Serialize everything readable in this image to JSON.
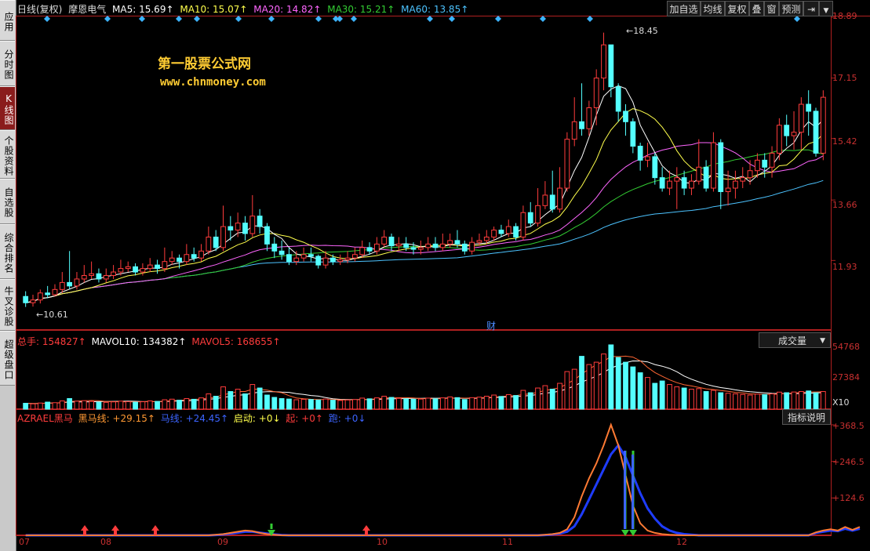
{
  "sidebar": {
    "items": [
      {
        "label": "应用"
      },
      {
        "label": "分时图"
      },
      {
        "label": "K线图"
      },
      {
        "label": "个股资料"
      },
      {
        "label": "自选股"
      },
      {
        "label": "综合排名"
      },
      {
        "label": "牛叉诊股"
      },
      {
        "label": "超级盘口"
      }
    ]
  },
  "toolbar": {
    "add_watch": "加自选",
    "ma_line": "均线",
    "rights": "复权",
    "overlay": "叠",
    "window": "窗",
    "forecast": "预测",
    "exit_icon": "exit-icon",
    "menu_icon": "triangle-down-icon"
  },
  "kline_header": {
    "period": "日线(复权)",
    "stock_name": "摩恩电气",
    "ma5": "MA5: 15.69↑",
    "ma10": "MA10: 15.07↑",
    "ma20": "MA20: 14.82↑",
    "ma30": "MA30: 15.21↑",
    "ma60": "MA60: 13.85↑"
  },
  "watermark": {
    "line1": "第一股票公式网",
    "line2": "www.chnmoney.com"
  },
  "price_axis": [
    "18.89",
    "17.15",
    "15.42",
    "13.66",
    "11.93"
  ],
  "price_annotations": {
    "high": "18.45",
    "low": "10.61",
    "cai": "财"
  },
  "volume_header": {
    "total": "总手: 154827↑",
    "mavol10": "MAVOL10: 134382↑",
    "mavol5": "MAVOL5: 168655↑",
    "selector": "成交量"
  },
  "volume_axis": [
    "54768",
    "27384",
    "X10"
  ],
  "indicator_header": {
    "name": "AZRAEL黑马",
    "heima": "黑马线: +29.15↑",
    "ma": "马线: +24.45↑",
    "qidong": "启动: +0↓",
    "qi": "起: +0↑",
    "pao": "跑: +0↓",
    "help": "指标说明"
  },
  "indicator_axis": [
    "+368.5",
    "+246.5",
    "+124.6"
  ],
  "x_axis": [
    "07",
    "08",
    "09",
    "10",
    "11",
    "12"
  ],
  "colors": {
    "up": "#ff3c3c",
    "down": "#54ffff",
    "ma5": "#ffffff",
    "ma10": "#ffff4c",
    "ma20": "#ff66ff",
    "ma30": "#33cc33",
    "ma60": "#4cc3ff",
    "frame": "#b02020"
  },
  "chart_data": {
    "type": "candlestick",
    "price_range": [
      10.3,
      18.89
    ],
    "candles": [
      [
        10.9,
        10.72,
        11.05,
        10.6
      ],
      [
        10.72,
        10.8,
        10.95,
        10.61
      ],
      [
        10.8,
        11.0,
        11.1,
        10.7
      ],
      [
        11.0,
        10.95,
        11.2,
        10.85
      ],
      [
        10.95,
        11.1,
        11.25,
        10.9
      ],
      [
        11.1,
        11.3,
        11.6,
        11.0
      ],
      [
        11.3,
        11.2,
        12.2,
        11.1
      ],
      [
        11.2,
        11.4,
        11.6,
        11.1
      ],
      [
        11.4,
        11.5,
        11.8,
        11.3
      ],
      [
        11.5,
        11.55,
        11.9,
        11.4
      ],
      [
        11.55,
        11.4,
        11.7,
        11.3
      ],
      [
        11.4,
        11.5,
        11.7,
        11.3
      ],
      [
        11.5,
        11.6,
        11.8,
        11.4
      ],
      [
        11.6,
        11.7,
        11.95,
        11.5
      ],
      [
        11.7,
        11.75,
        11.9,
        11.6
      ],
      [
        11.75,
        11.6,
        11.85,
        11.5
      ],
      [
        11.6,
        11.7,
        11.85,
        11.5
      ],
      [
        11.7,
        11.8,
        12.0,
        11.6
      ],
      [
        11.8,
        11.7,
        11.95,
        11.55
      ],
      [
        11.7,
        11.9,
        12.3,
        11.6
      ],
      [
        11.9,
        12.0,
        12.2,
        11.8
      ],
      [
        12.0,
        11.9,
        12.1,
        11.7
      ],
      [
        11.9,
        12.1,
        12.4,
        11.8
      ],
      [
        12.1,
        12.0,
        12.3,
        11.9
      ],
      [
        12.0,
        12.2,
        12.4,
        11.9
      ],
      [
        12.2,
        12.6,
        12.9,
        12.1
      ],
      [
        12.6,
        12.3,
        12.8,
        12.2
      ],
      [
        12.3,
        12.9,
        13.5,
        12.2
      ],
      [
        12.9,
        12.8,
        13.2,
        12.5
      ],
      [
        12.8,
        13.0,
        13.3,
        12.6
      ],
      [
        13.0,
        12.7,
        13.2,
        12.5
      ],
      [
        12.7,
        13.2,
        13.8,
        12.6
      ],
      [
        13.2,
        12.9,
        13.4,
        12.7
      ],
      [
        12.9,
        12.4,
        13.0,
        12.2
      ],
      [
        12.4,
        12.2,
        12.6,
        12.0
      ],
      [
        12.2,
        12.1,
        12.5,
        11.95
      ],
      [
        12.1,
        11.9,
        12.3,
        11.8
      ],
      [
        11.9,
        12.0,
        12.2,
        11.8
      ],
      [
        12.0,
        12.1,
        12.3,
        11.9
      ],
      [
        12.1,
        12.05,
        12.3,
        11.9
      ],
      [
        12.05,
        11.8,
        12.1,
        11.7
      ],
      [
        11.8,
        12.0,
        12.2,
        11.7
      ],
      [
        12.0,
        11.9,
        12.1,
        11.8
      ],
      [
        11.9,
        11.95,
        12.1,
        11.8
      ],
      [
        11.95,
        12.0,
        12.2,
        11.85
      ],
      [
        12.0,
        12.1,
        12.3,
        11.9
      ],
      [
        12.1,
        12.3,
        12.5,
        12.0
      ],
      [
        12.3,
        12.2,
        12.45,
        12.1
      ],
      [
        12.2,
        12.4,
        12.6,
        12.1
      ],
      [
        12.4,
        12.6,
        12.8,
        12.3
      ],
      [
        12.6,
        12.35,
        12.7,
        12.2
      ],
      [
        12.35,
        12.4,
        12.6,
        12.2
      ],
      [
        12.4,
        12.3,
        12.6,
        12.2
      ],
      [
        12.3,
        12.25,
        12.45,
        12.1
      ],
      [
        12.25,
        12.3,
        12.5,
        12.1
      ],
      [
        12.3,
        12.4,
        12.6,
        12.2
      ],
      [
        12.4,
        12.3,
        12.6,
        12.2
      ],
      [
        12.3,
        12.4,
        12.7,
        12.2
      ],
      [
        12.4,
        12.5,
        12.7,
        12.3
      ],
      [
        12.5,
        12.4,
        12.8,
        12.3
      ],
      [
        12.4,
        12.2,
        12.5,
        12.1
      ],
      [
        12.2,
        12.45,
        12.6,
        12.1
      ],
      [
        12.45,
        12.5,
        12.7,
        12.35
      ],
      [
        12.5,
        12.6,
        12.8,
        12.4
      ],
      [
        12.6,
        12.8,
        12.9,
        12.5
      ],
      [
        12.8,
        12.7,
        12.95,
        12.6
      ],
      [
        12.7,
        12.9,
        13.1,
        12.6
      ],
      [
        12.9,
        12.6,
        13.0,
        12.5
      ],
      [
        12.6,
        13.3,
        13.5,
        12.5
      ],
      [
        13.3,
        13.0,
        13.6,
        12.9
      ],
      [
        13.0,
        13.5,
        14.0,
        12.9
      ],
      [
        13.5,
        13.8,
        14.2,
        13.4
      ],
      [
        13.8,
        13.4,
        14.5,
        13.3
      ],
      [
        13.4,
        14.0,
        14.6,
        13.3
      ],
      [
        14.0,
        15.4,
        15.6,
        13.9
      ],
      [
        15.4,
        15.9,
        16.6,
        15.2
      ],
      [
        15.9,
        15.7,
        17.0,
        15.5
      ],
      [
        15.7,
        16.3,
        16.5,
        15.5
      ],
      [
        16.3,
        17.15,
        17.4,
        15.8
      ],
      [
        17.15,
        18.1,
        18.45,
        16.8
      ],
      [
        18.1,
        16.9,
        17.5,
        16.6
      ],
      [
        16.9,
        16.2,
        17.0,
        15.9
      ],
      [
        16.2,
        15.9,
        16.4,
        15.5
      ],
      [
        15.9,
        15.2,
        16.0,
        15.0
      ],
      [
        15.2,
        14.8,
        15.3,
        14.5
      ],
      [
        14.8,
        14.9,
        15.3,
        14.6
      ],
      [
        14.9,
        14.3,
        15.0,
        14.1
      ],
      [
        14.3,
        14.0,
        14.6,
        13.9
      ],
      [
        14.0,
        14.2,
        14.5,
        13.8
      ],
      [
        14.2,
        14.3,
        14.6,
        13.4
      ],
      [
        14.3,
        14.0,
        14.5,
        13.8
      ],
      [
        14.0,
        14.2,
        14.4,
        13.8
      ],
      [
        14.2,
        14.6,
        15.4,
        14.1
      ],
      [
        14.6,
        14.0,
        14.8,
        13.9
      ],
      [
        14.0,
        15.3,
        15.6,
        13.9
      ],
      [
        15.3,
        13.9,
        15.4,
        13.4
      ],
      [
        13.9,
        14.0,
        14.5,
        13.5
      ],
      [
        14.0,
        14.2,
        14.5,
        13.7
      ],
      [
        14.2,
        14.3,
        14.6,
        14.0
      ],
      [
        14.3,
        14.5,
        14.8,
        14.1
      ],
      [
        14.5,
        14.8,
        15.0,
        14.3
      ],
      [
        14.8,
        14.6,
        15.0,
        14.3
      ],
      [
        14.6,
        15.0,
        15.2,
        14.3
      ],
      [
        15.0,
        15.8,
        16.0,
        14.8
      ],
      [
        15.8,
        15.5,
        16.1,
        15.2
      ],
      [
        15.5,
        15.6,
        16.2,
        15.1
      ],
      [
        15.6,
        16.4,
        16.6,
        15.1
      ],
      [
        16.4,
        16.2,
        16.8,
        15.5
      ],
      [
        16.2,
        15.0,
        16.3,
        14.9
      ],
      [
        15.0,
        16.6,
        16.8,
        14.8
      ]
    ],
    "volume_range": [
      0,
      54768
    ],
    "volumes": [
      5000,
      4500,
      5200,
      6000,
      5500,
      7000,
      9000,
      6800,
      7200,
      6600,
      6000,
      5800,
      6200,
      6800,
      6400,
      5900,
      6300,
      7000,
      6600,
      8000,
      8500,
      7600,
      9000,
      8400,
      9600,
      13000,
      11000,
      19000,
      15000,
      17000,
      13000,
      21000,
      18000,
      12000,
      10000,
      9000,
      8600,
      8000,
      8400,
      8200,
      7800,
      8600,
      7600,
      7400,
      7800,
      8200,
      9400,
      8800,
      9600,
      11000,
      10000,
      9200,
      8800,
      8400,
      8600,
      9400,
      8800,
      9600,
      10400,
      9800,
      8200,
      9800,
      10200,
      11000,
      12000,
      10800,
      12400,
      11600,
      16000,
      14000,
      18000,
      20000,
      17000,
      22000,
      32000,
      34000,
      45000,
      38000,
      40000,
      47000,
      54768,
      44000,
      40000,
      36000,
      31000,
      27000,
      22000,
      24000,
      21000,
      19000,
      18000,
      17000,
      17500,
      15000,
      16000,
      14000,
      13500,
      13000,
      12500,
      12000,
      12800,
      12400,
      13000,
      14500,
      14000,
      14600,
      15000,
      15500,
      14000,
      15000
    ],
    "indicator_range": [
      0,
      368.5
    ],
    "heima": [
      0,
      0,
      0,
      0,
      0,
      0,
      0,
      0,
      0,
      0,
      0,
      0,
      0,
      0,
      0,
      0,
      0,
      0,
      0,
      0,
      0,
      0,
      0,
      0,
      0,
      0,
      2,
      4,
      8,
      12,
      16,
      14,
      8,
      4,
      2,
      0,
      0,
      0,
      0,
      0,
      0,
      0,
      0,
      0,
      0,
      0,
      0,
      0,
      0,
      0,
      0,
      0,
      0,
      0,
      0,
      0,
      0,
      0,
      0,
      0,
      0,
      0,
      0,
      0,
      0,
      0,
      0,
      0,
      0,
      0,
      0,
      2,
      4,
      8,
      20,
      60,
      130,
      190,
      240,
      300,
      368.5,
      300,
      200,
      100,
      40,
      16,
      8,
      4,
      2,
      1,
      0,
      0,
      0,
      0,
      0,
      0,
      0,
      0,
      0,
      0,
      0,
      0,
      0,
      0,
      0,
      0,
      0,
      0,
      10,
      16,
      20,
      16,
      28,
      18,
      28
    ],
    "maline": [
      0,
      0,
      0,
      0,
      0,
      0,
      0,
      0,
      0,
      0,
      0,
      0,
      0,
      0,
      0,
      0,
      0,
      0,
      0,
      0,
      0,
      0,
      0,
      0,
      0,
      0,
      1,
      3,
      6,
      9,
      12,
      12,
      9,
      6,
      3,
      1,
      0,
      0,
      0,
      0,
      0,
      0,
      0,
      0,
      0,
      0,
      0,
      0,
      0,
      0,
      0,
      0,
      0,
      0,
      0,
      0,
      0,
      0,
      0,
      0,
      0,
      0,
      0,
      0,
      0,
      0,
      0,
      0,
      0,
      0,
      0,
      1,
      3,
      6,
      12,
      30,
      70,
      120,
      170,
      220,
      270,
      300,
      260,
      200,
      140,
      90,
      56,
      30,
      16,
      8,
      4,
      2,
      0,
      0,
      0,
      0,
      0,
      0,
      0,
      0,
      0,
      0,
      0,
      0,
      0,
      0,
      0,
      0,
      8,
      12,
      16,
      14,
      22,
      16,
      22
    ]
  }
}
